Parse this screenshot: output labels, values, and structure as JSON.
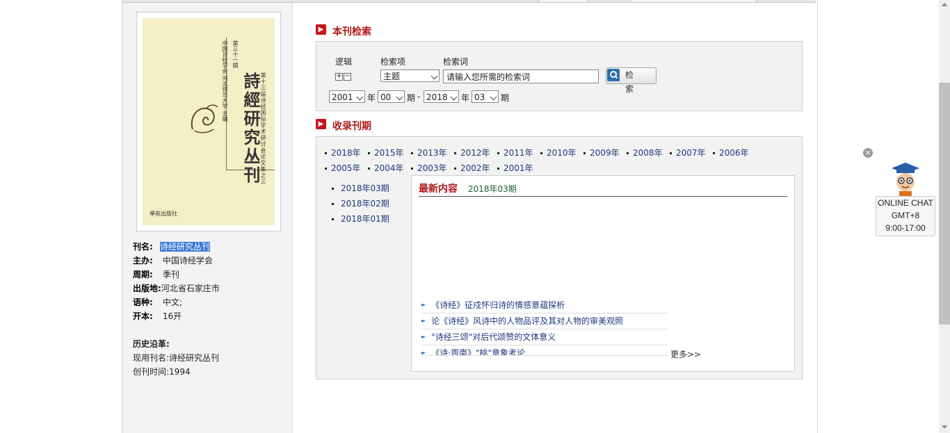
{
  "journal": {
    "cover": {
      "title": "詩經研究丛刊",
      "volume": "第三十一辑",
      "subtitle": "第十三届诗经国际学术研讨会论文集之三",
      "editor": "中国诗经学会 河北师范大学 主编",
      "publisher": "學苑出版社"
    },
    "info": [
      {
        "label": "刊名:",
        "value": "诗经研究丛刊"
      },
      {
        "label": "主办:",
        "value": "中国诗经学会"
      },
      {
        "label": "周期:",
        "value": "季刊"
      },
      {
        "label": "出版地:",
        "value": "河北省石家庄市"
      },
      {
        "label": "语种:",
        "value": "中文;"
      },
      {
        "label": "开本:",
        "value": "16开"
      }
    ],
    "history": {
      "heading": "历史沿革:",
      "current_name_label": "现用刊名:",
      "current_name": "诗经研究丛刊",
      "founded_label": "创刊时间:",
      "founded": "1994"
    }
  },
  "search": {
    "heading": "本刊检索",
    "logic_label": "逻辑",
    "field_label": "检索项",
    "keyword_label": "检索词",
    "field_value": "主题",
    "keyword_placeholder": "请输入您所需的检索词",
    "button": "检 索",
    "year_from": "2001",
    "issue_from": "00",
    "year_to": "2018",
    "issue_to": "03",
    "year_unit": "年",
    "issue_unit": "期",
    "dash": "-"
  },
  "issues": {
    "heading": "收录刊期",
    "years": [
      "2018年",
      "2015年",
      "2013年",
      "2012年",
      "2011年",
      "2010年",
      "2009年",
      "2008年",
      "2007年",
      "2006年",
      "2005年",
      "2004年",
      "2003年",
      "2002年",
      "2001年"
    ],
    "issue_list": [
      "2018年03期",
      "2018年02期",
      "2018年01期"
    ],
    "latest_label": "最新内容",
    "latest_issue": "2018年03期",
    "articles": [
      "《诗经》征戍怀归诗的情感意蕴探析",
      "论《诗经》风诗中的人物品评及其对人物的审美观照",
      "\"诗经三颂\"对后代颂赞的文体意义",
      "《诗·周南》\"桃\"意象考论"
    ],
    "more": "更多>>"
  },
  "chat": {
    "line1": "ONLINE CHAT",
    "line2": "GMT+8",
    "line3": "9:00-17:00",
    "close": "×"
  }
}
